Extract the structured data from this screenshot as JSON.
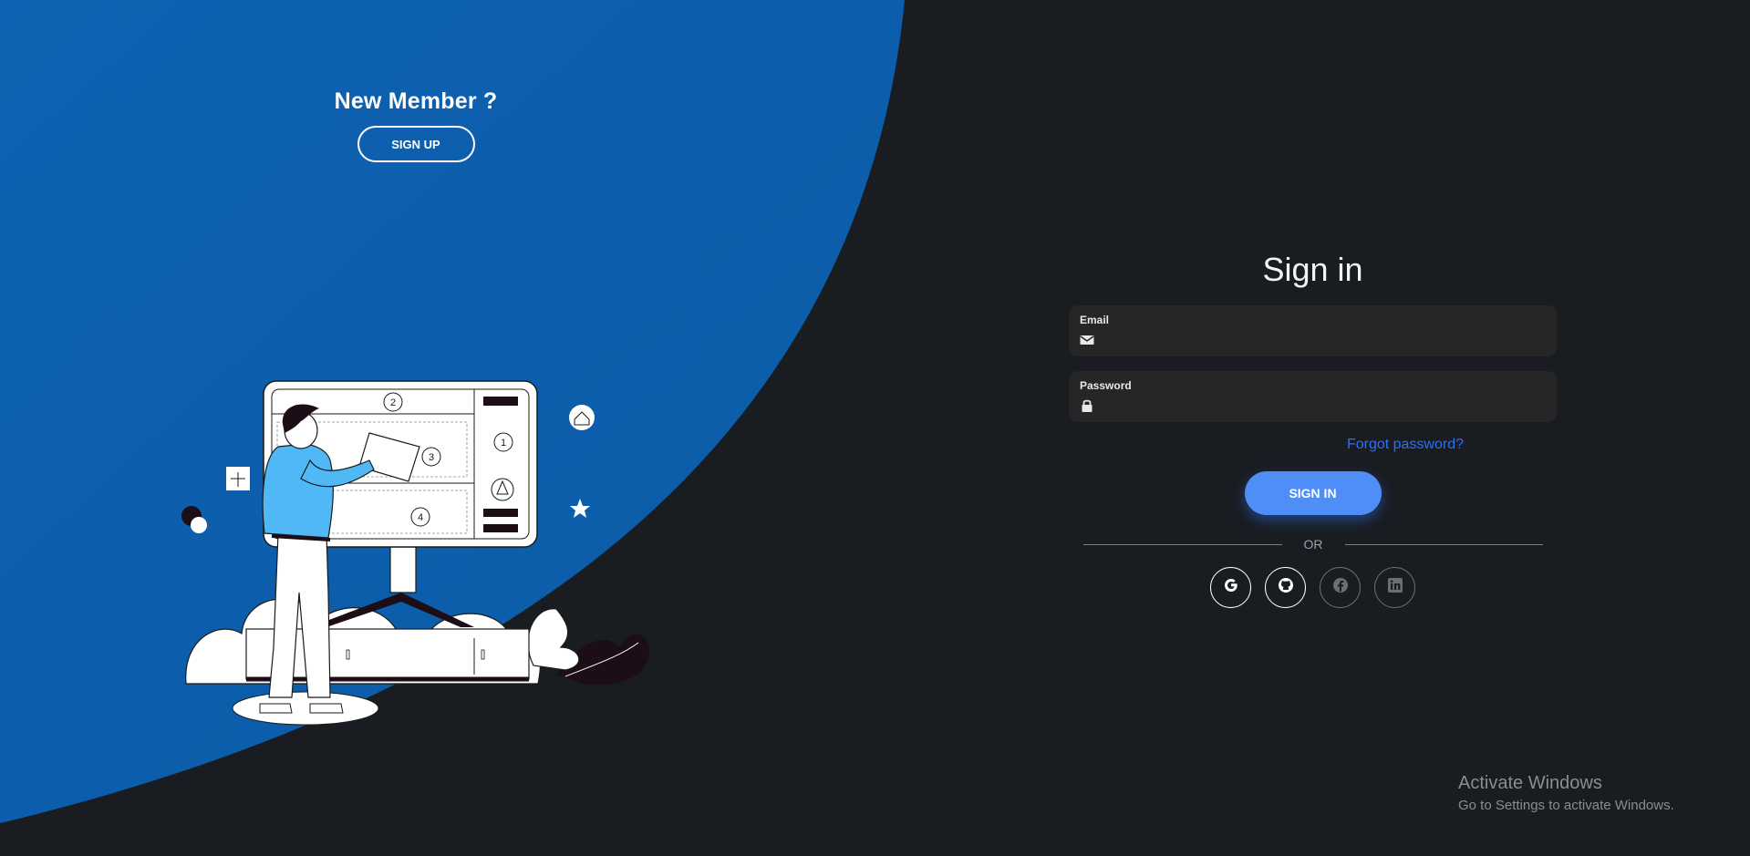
{
  "left_panel": {
    "heading": "New Member ?",
    "signup_label": "SIGN UP",
    "illustration": {
      "board_numbers": [
        "2",
        "3",
        "1",
        "4"
      ]
    }
  },
  "form": {
    "title": "Sign in",
    "email": {
      "label": "Email",
      "value": "",
      "placeholder": "",
      "icon": "envelope-icon"
    },
    "password": {
      "label": "Password",
      "value": "",
      "placeholder": "",
      "icon": "lock-icon"
    },
    "forgot_label": "Forgot password?",
    "signin_label": "SIGN IN",
    "divider_label": "OR",
    "social": [
      {
        "name": "google-icon"
      },
      {
        "name": "github-icon"
      },
      {
        "name": "facebook-icon"
      },
      {
        "name": "linkedin-icon"
      }
    ]
  },
  "watermark": {
    "title": "Activate Windows",
    "subtitle": "Go to Settings to activate Windows."
  },
  "colors": {
    "background": "#191d22",
    "panel_blue": "#0c5ca8",
    "accent": "#4f8ef7",
    "link": "#2e6ef5",
    "field_bg": "#262626"
  }
}
